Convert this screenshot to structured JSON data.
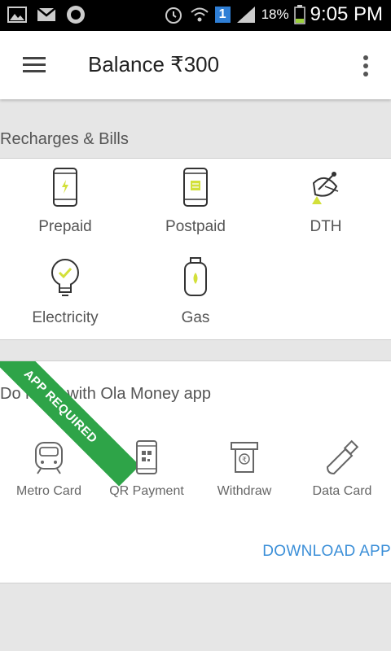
{
  "status_bar": {
    "battery": "18%",
    "time": "9:05 PM",
    "notification_count": "1"
  },
  "app_bar": {
    "title": "Balance ₹300",
    "menu_icon": "hamburger-menu-icon",
    "overflow_icon": "more-vert-icon"
  },
  "recharges": {
    "header": "Recharges & Bills",
    "items": [
      {
        "label": "Prepaid",
        "icon": "prepaid-phone-icon"
      },
      {
        "label": "Postpaid",
        "icon": "postpaid-phone-icon"
      },
      {
        "label": "DTH",
        "icon": "dish-antenna-icon"
      },
      {
        "label": "Electricity",
        "icon": "bulb-icon"
      },
      {
        "label": "Gas",
        "icon": "gas-cylinder-icon"
      }
    ]
  },
  "app_section": {
    "header": "Do more with Ola Money app",
    "ribbon": "APP REQUIRED",
    "items": [
      {
        "label": "Metro Card",
        "icon": "metro-train-icon"
      },
      {
        "label": "QR Payment",
        "icon": "qr-phone-icon"
      },
      {
        "label": "Withdraw",
        "icon": "atm-withdraw-icon"
      },
      {
        "label": "Data Card",
        "icon": "usb-data-card-icon"
      }
    ],
    "download": "DOWNLOAD APP"
  },
  "colors": {
    "accent_green": "#2ea448",
    "link_blue": "#3b8fd8",
    "icon_yellow": "#d3e03a"
  }
}
